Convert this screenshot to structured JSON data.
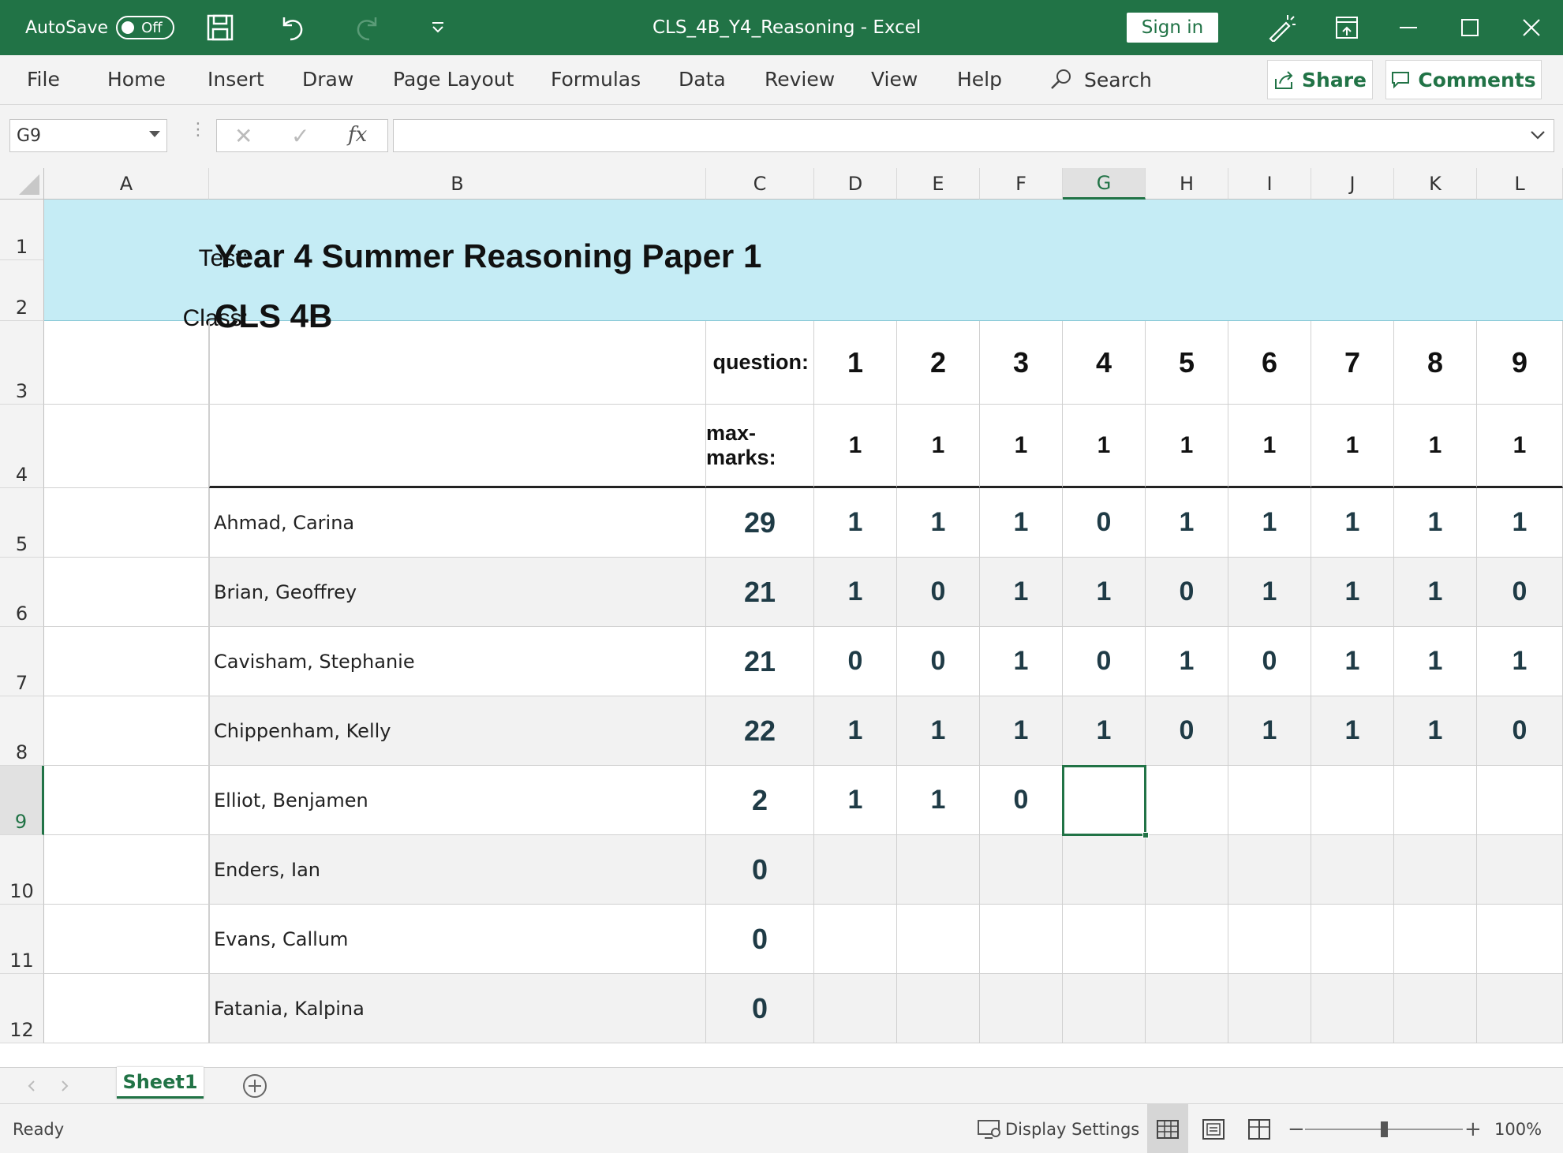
{
  "titlebar": {
    "autosave_label": "AutoSave",
    "autosave_state": "Off",
    "document_title": "CLS_4B_Y4_Reasoning  -  Excel",
    "signin_label": "Sign in",
    "accent_color": "#217346"
  },
  "ribbon": {
    "tabs": [
      "File",
      "Home",
      "Insert",
      "Draw",
      "Page Layout",
      "Formulas",
      "Data",
      "Review",
      "View",
      "Help"
    ],
    "search_label": "Search",
    "share_label": "Share",
    "comments_label": "Comments"
  },
  "formula_bar": {
    "name_box": "G9",
    "fx_label": "fx",
    "formula": ""
  },
  "grid": {
    "columns": [
      "A",
      "B",
      "C",
      "D",
      "E",
      "F",
      "G",
      "H",
      "I",
      "J",
      "K",
      "L"
    ],
    "selected_column": "G",
    "rows": [
      "1",
      "2",
      "3",
      "4",
      "5",
      "6",
      "7",
      "8",
      "9",
      "10",
      "11",
      "12"
    ],
    "selected_row": "9",
    "banner": {
      "test_label": "Test:",
      "test_value": "Year 4 Summer Reasoning Paper 1",
      "class_label": "Class:",
      "class_value": "CLS 4B",
      "fill_color": "#c5ecf5"
    },
    "question_label": "question:",
    "questions": [
      "1",
      "2",
      "3",
      "4",
      "5",
      "6",
      "7",
      "8",
      "9"
    ],
    "max_marks_label": "max-marks:",
    "max_marks": [
      "1",
      "1",
      "1",
      "1",
      "1",
      "1",
      "1",
      "1",
      "1"
    ],
    "students": [
      {
        "name": "Ahmad, Carina",
        "score": "29",
        "marks": [
          "1",
          "1",
          "1",
          "0",
          "1",
          "1",
          "1",
          "1",
          "1"
        ]
      },
      {
        "name": "Brian, Geoffrey",
        "score": "21",
        "marks": [
          "1",
          "0",
          "1",
          "1",
          "0",
          "1",
          "1",
          "1",
          "0"
        ]
      },
      {
        "name": "Cavisham, Stephanie",
        "score": "21",
        "marks": [
          "0",
          "0",
          "1",
          "0",
          "1",
          "0",
          "1",
          "1",
          "1"
        ]
      },
      {
        "name": "Chippenham, Kelly",
        "score": "22",
        "marks": [
          "1",
          "1",
          "1",
          "1",
          "0",
          "1",
          "1",
          "1",
          "0"
        ]
      },
      {
        "name": "Elliot, Benjamen",
        "score": "2",
        "marks": [
          "1",
          "1",
          "0",
          "",
          "",
          "",
          "",
          "",
          ""
        ]
      },
      {
        "name": "Enders, Ian",
        "score": "0",
        "marks": [
          "",
          "",
          "",
          "",
          "",
          "",
          "",
          "",
          ""
        ]
      },
      {
        "name": "Evans, Callum",
        "score": "0",
        "marks": [
          "",
          "",
          "",
          "",
          "",
          "",
          "",
          "",
          ""
        ]
      },
      {
        "name": "Fatania, Kalpina",
        "score": "0",
        "marks": [
          "",
          "",
          "",
          "",
          "",
          "",
          "",
          "",
          ""
        ]
      }
    ]
  },
  "sheets": {
    "tabs": [
      "Sheet1"
    ]
  },
  "statusbar": {
    "status": "Ready",
    "display_settings": "Display Settings",
    "zoom": "100%"
  }
}
